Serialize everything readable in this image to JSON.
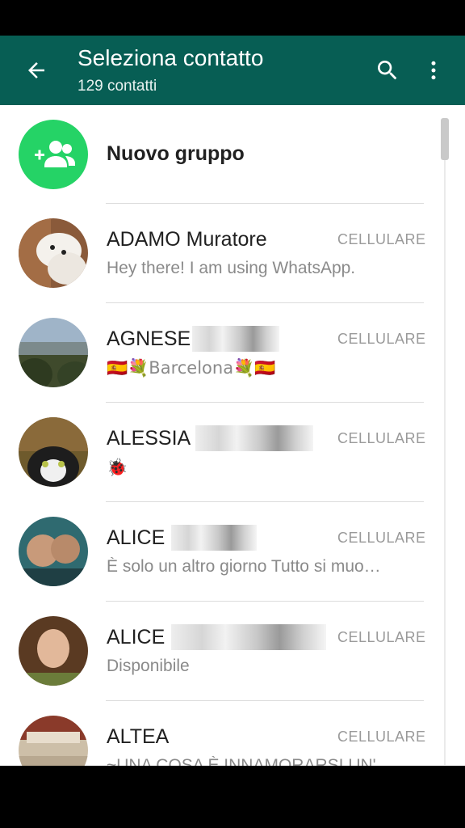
{
  "header": {
    "title": "Seleziona contatto",
    "subtitle": "129 contatti",
    "icons": {
      "back": "arrow-back-icon",
      "search": "search-icon",
      "more": "more-vert-icon"
    },
    "color": "#075e54"
  },
  "new_group": {
    "label": "Nuovo gruppo",
    "icon": "group-add-icon",
    "color": "#25d366"
  },
  "contacts": [
    {
      "name": "ADAMO Muratore",
      "type": "CELLULARE",
      "status": "Hey there! I am using WhatsApp."
    },
    {
      "name": "AGNESE",
      "type": "CELLULARE",
      "status": "🇪🇸💐Barcelona💐🇪🇸"
    },
    {
      "name": "ALESSIA",
      "type": "CELLULARE",
      "status": "🐞"
    },
    {
      "name": "ALICE",
      "type": "CELLULARE",
      "status": "È solo un altro giorno Tutto si muo…"
    },
    {
      "name": "ALICE",
      "type": "CELLULARE",
      "status": "Disponibile"
    },
    {
      "name": "ALTEA",
      "type": "CELLULARE",
      "status": "~UNA COSA È INNAMORARSI UN'"
    }
  ]
}
